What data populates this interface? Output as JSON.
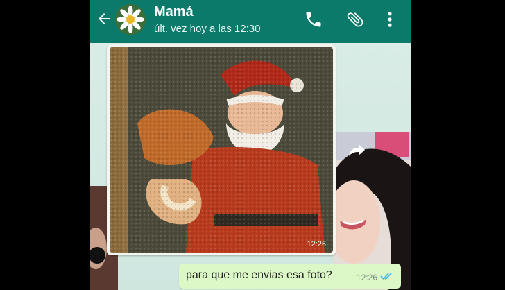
{
  "header": {
    "contact_name": "Mamá",
    "status": "últ. vez hoy a las 12:30",
    "color": "#0b7a6b",
    "icons": [
      "back-arrow-icon",
      "phone-icon",
      "paperclip-icon",
      "more-vert-icon"
    ]
  },
  "messages": {
    "image_message": {
      "time": "12:26"
    },
    "text_message": {
      "text": "para que me envias esa foto?",
      "time": "12:26",
      "status_icon": "double-check-icon",
      "bubble_color": "#dcf8c6"
    }
  }
}
